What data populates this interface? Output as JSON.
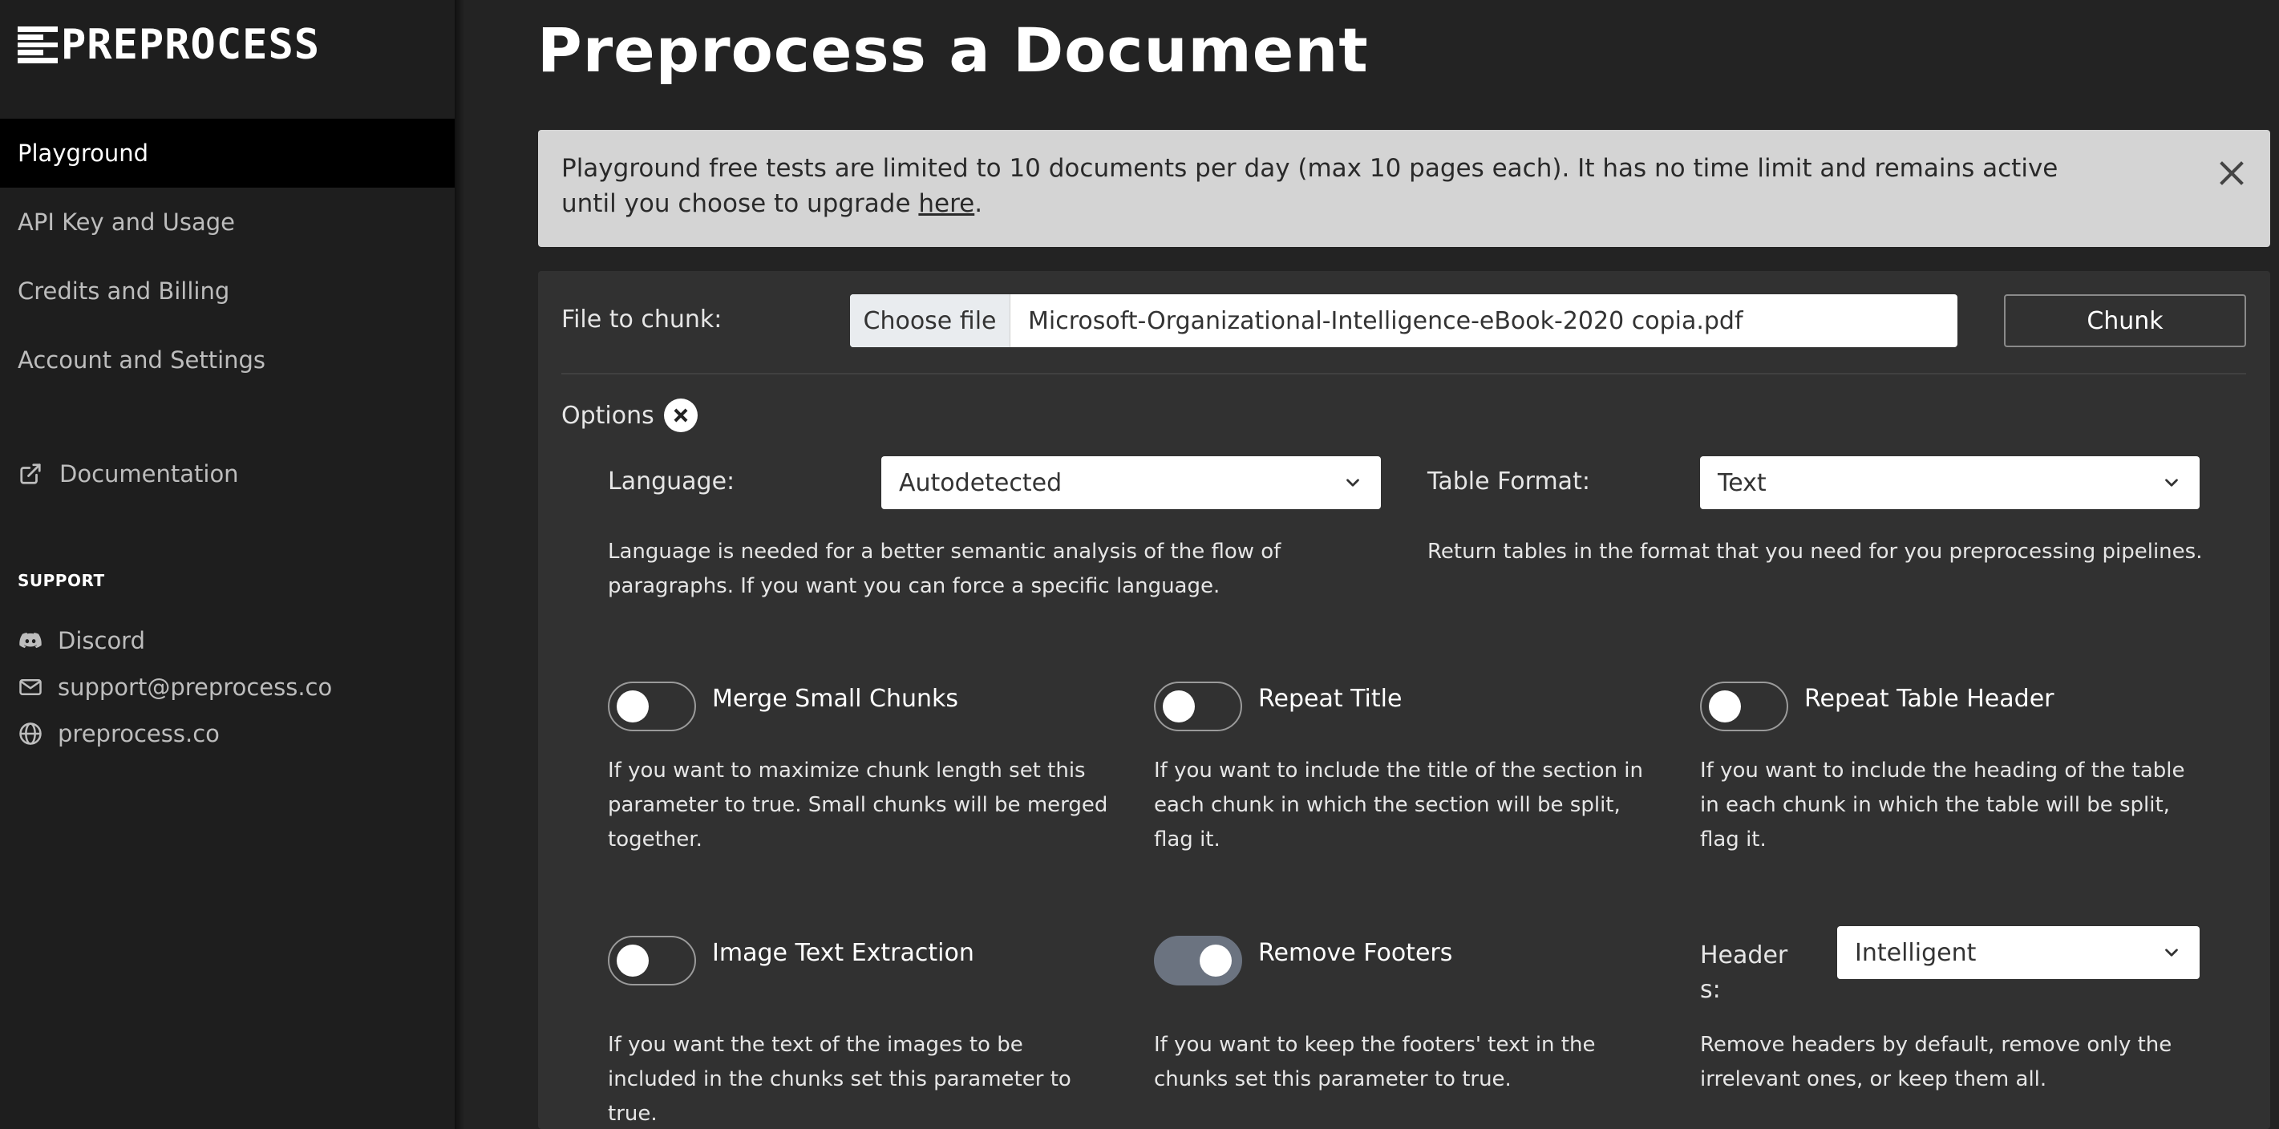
{
  "brand": {
    "name": "PREPROCESS"
  },
  "sidebar": {
    "items": [
      {
        "label": "Playground",
        "active": true
      },
      {
        "label": "API Key and Usage",
        "active": false
      },
      {
        "label": "Credits and Billing",
        "active": false
      },
      {
        "label": "Account and Settings",
        "active": false
      }
    ],
    "documentation": {
      "label": "Documentation",
      "icon": "external-link-icon"
    },
    "support": {
      "heading": "SUPPORT",
      "items": [
        {
          "label": "Discord",
          "icon": "discord-icon"
        },
        {
          "label": "support@preprocess.co",
          "icon": "mail-icon"
        },
        {
          "label": "preprocess.co",
          "icon": "globe-icon"
        }
      ]
    }
  },
  "main": {
    "title": "Preprocess a Document",
    "alert": {
      "text": "Playground free tests are limited to 10 documents per day (max 10 pages each). It has no time limit and remains active until you choose to upgrade ",
      "link_text": "here",
      "suffix": "."
    },
    "file": {
      "label": "File to chunk:",
      "choose_label": "Choose file",
      "filename": "Microsoft-Organizational-Intelligence-eBook-2020 copia.pdf",
      "chunk_label": "Chunk"
    },
    "options": {
      "heading": "Options",
      "language": {
        "label": "Language:",
        "value": "Autodetected",
        "help": "Language is needed for a better semantic analysis of the flow of paragraphs. If you want you can force a specific language."
      },
      "table_format": {
        "label": "Table Format:",
        "value": "Text",
        "help": "Return tables in the format that you need for you preprocessing pipelines."
      },
      "merge_small_chunks": {
        "label": "Merge Small Chunks",
        "on": false,
        "help": "If you want to maximize chunk length set this parameter to true. Small chunks will be merged together."
      },
      "repeat_title": {
        "label": "Repeat Title",
        "on": false,
        "help": "If you want to include the title of the section in each chunk in which the section will be split, flag it."
      },
      "repeat_table_header": {
        "label": "Repeat Table Header",
        "on": false,
        "help": "If you want to include the heading of the table in each chunk in which the table will be split, flag it."
      },
      "image_text_extraction": {
        "label": "Image Text Extraction",
        "on": false,
        "help": "If you want the text of the images to be included in the chunks set this parameter to true."
      },
      "remove_footers": {
        "label": "Remove Footers",
        "on": true,
        "help": "If you want to keep the footers' text in the chunks set this parameter to true."
      },
      "headers": {
        "label": "Headers:",
        "value": "Intelligent",
        "help": "Remove headers by default, remove only the irrelevant ones, or keep them all."
      }
    }
  }
}
